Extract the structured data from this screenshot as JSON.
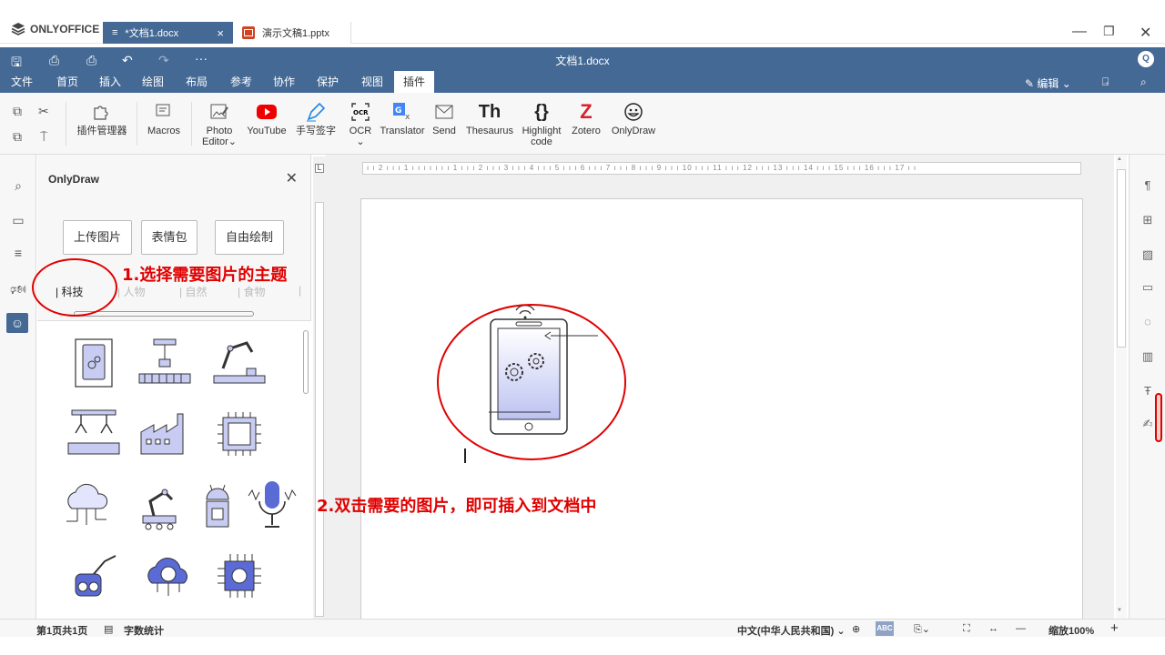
{
  "app": {
    "brand": "ONLYOFFICE"
  },
  "tabs": [
    {
      "label": "*文档1.docx",
      "active": true
    },
    {
      "label": "演示文稿1.pptx",
      "active": false
    }
  ],
  "window": {
    "minimize": "—",
    "restore": "❐",
    "close": "✕"
  },
  "title": "文档1.docx",
  "user_initial": "Q",
  "menu": {
    "items": [
      "文件",
      "首页",
      "插入",
      "绘图",
      "布局",
      "参考",
      "协作",
      "保护",
      "视图",
      "插件"
    ],
    "active": "插件",
    "edit_mode": "编辑"
  },
  "toolbar": {
    "plugin_manager": "插件管理器",
    "macros": "Macros",
    "photo_editor_line1": "Photo",
    "photo_editor_line2": "Editor",
    "youtube": "YouTube",
    "handwriting": "手写签字",
    "ocr": "OCR",
    "translator": "Translator",
    "send": "Send",
    "thesaurus": "Thesaurus",
    "highlight_line1": "Highlight",
    "highlight_line2": "code",
    "zotero": "Zotero",
    "onlydraw": "OnlyDraw"
  },
  "plugin": {
    "title": "OnlyDraw",
    "buttons": [
      "上传图片",
      "表情包",
      "自由绘制"
    ],
    "categories": [
      "科技",
      "人物",
      "自然",
      "食物"
    ],
    "selected_category": "科技"
  },
  "ruler": {
    "marks": "ı ı 2 ı ı ı 1 ı ı ı ı ı ı ı 1 ı ı ı 2 ı ı ı 3 ı ı ı 4 ı ı ı 5 ı ı ı 6 ı ı ı 7 ı ı ı 8 ı ı ı 9 ı ı ı 10 ı ı ı 11 ı ı ı 12 ı ı ı 13 ı ı ı 14 ı ı ı 15 ı ı ı 16 ı ı ı 17 ı ı"
  },
  "annotations": {
    "step1": "1.选择需要图片的主题",
    "step2": "2.双击需要的图片，即可插入到文档中"
  },
  "status": {
    "page": "第1页共1页",
    "word_count": "字数统计",
    "language": "中文(中华人民共和国)",
    "zoom": "缩放100%"
  },
  "colors": {
    "accent": "#446995",
    "annotation": "#e00000",
    "icon_blue": "#5b6bd6"
  }
}
